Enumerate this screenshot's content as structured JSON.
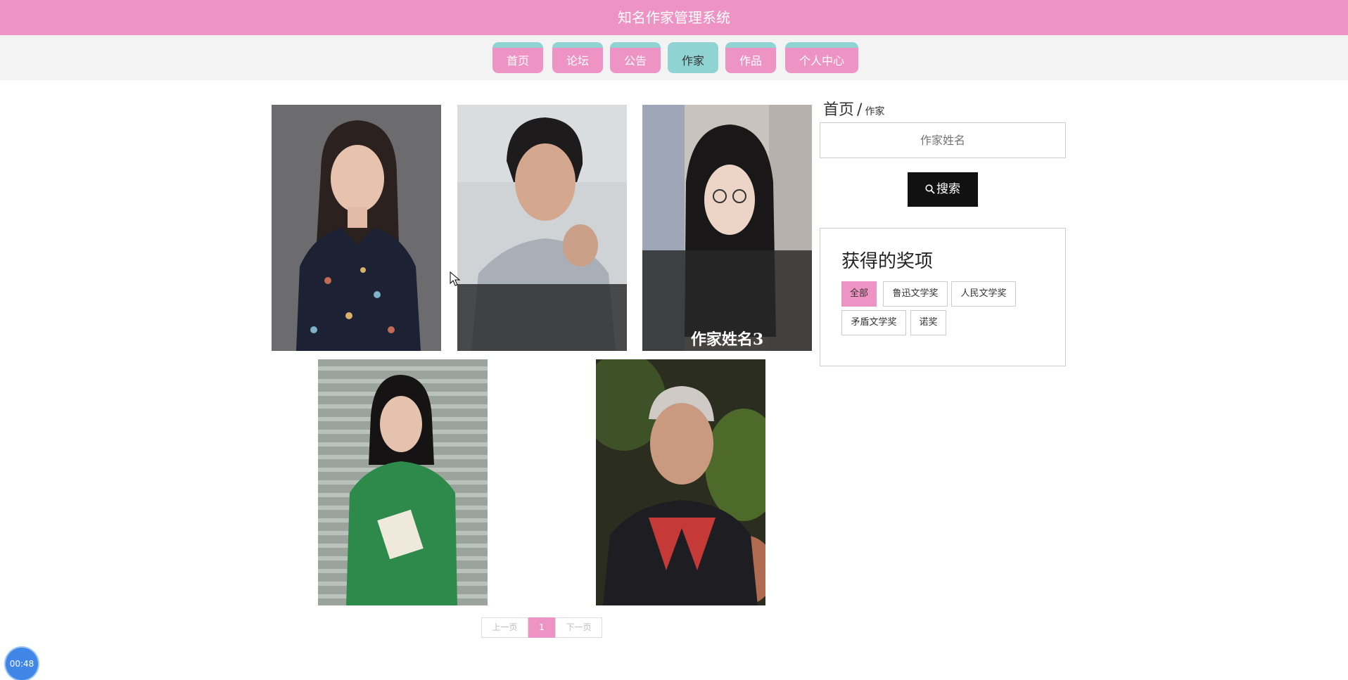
{
  "app": {
    "title": "知名作家管理系统"
  },
  "nav": {
    "items": [
      {
        "label": "首页"
      },
      {
        "label": "论坛"
      },
      {
        "label": "公告"
      },
      {
        "label": "作家"
      },
      {
        "label": "作品"
      },
      {
        "label": "个人中心"
      }
    ],
    "active": "作家"
  },
  "writers": [
    {
      "caption": ""
    },
    {
      "caption": ""
    },
    {
      "caption": "作家姓名3"
    },
    {
      "caption": ""
    },
    {
      "caption": ""
    }
  ],
  "breadcrumb": {
    "home": "首页",
    "separator": "/",
    "current": "作家"
  },
  "search": {
    "placeholder": "作家姓名",
    "button_label": "搜索",
    "icon": "search-icon"
  },
  "awards": {
    "title": "获得的奖项",
    "tags": [
      {
        "label": "全部",
        "active": true
      },
      {
        "label": "鲁迅文学奖"
      },
      {
        "label": "人民文学奖"
      },
      {
        "label": "矛盾文学奖"
      },
      {
        "label": "诺奖"
      }
    ]
  },
  "pagination": {
    "prev": "上一页",
    "current": "1",
    "next": "下一页"
  },
  "timer": {
    "value": "00:48"
  },
  "colors": {
    "header": "#ee94c5",
    "nav_active": "#8fd3d3",
    "accent": "#ee94c5"
  }
}
